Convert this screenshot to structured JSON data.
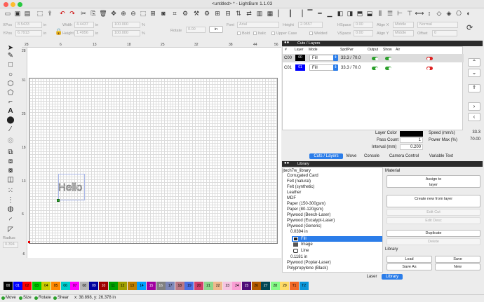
{
  "window": {
    "title": "<untitled> * - LightBurn 1.1.03"
  },
  "props_row1": {
    "xpos_label": "XPos",
    "xpos_value": "8.5433",
    "xpos_unit": "in",
    "width_label": "Width",
    "width_value": "4.4437",
    "width_unit": "in",
    "wpct": "100.000",
    "pct": "%",
    "font_label": "Font",
    "font_value": "Arial",
    "height_label": "Height",
    "height_value": "2.0557",
    "hspace_label": "HSpace",
    "hspace_value": "0.00",
    "alignx_label": "Align X",
    "alignx_value": "Middle",
    "normal_value": "Normal"
  },
  "props_row2": {
    "ypos_label": "YPos",
    "ypos_value": "6.7913",
    "ypos_unit": "in",
    "height_label": "Height",
    "height_value": "1.4956",
    "height_unit": "in",
    "hpct": "100.000",
    "pct": "%",
    "rotate_label": "Rotate",
    "rotate_value": "0.00",
    "units_button": "in",
    "bold": "Bold",
    "italic": "Italic",
    "upper": "Upper Case",
    "welded": "Welded",
    "vspace_label": "VSpace",
    "vspace_value": "0.00",
    "aligny_label": "Align Y",
    "aligny_value": "Middle",
    "offset_label": "Offset",
    "offset_value": "0"
  },
  "ruler_top": [
    "28",
    "6",
    "13",
    "18",
    "25",
    "32",
    "38",
    "44",
    "56"
  ],
  "ruler_left": [
    "28",
    "31",
    "25",
    "18",
    "13",
    "6",
    "-6"
  ],
  "canvas": {
    "text": "Hello"
  },
  "cuts_panel": {
    "title": "Cuts / Layers",
    "headers": [
      "#",
      "Layer",
      "Mode",
      "Spd/Pwr",
      "Output",
      "Show",
      "Air"
    ],
    "rows": [
      {
        "id": "C00",
        "layer": "00",
        "mode": "Fill",
        "spdpwr": "33.3 / 70.0",
        "color": "#000000"
      },
      {
        "id": "C01",
        "layer": "01",
        "mode": "Fill",
        "spdpwr": "33.3 / 70.0",
        "color": "#0000ff"
      }
    ],
    "layer_color_label": "Layer Color",
    "pass_count_label": "Pass Count",
    "pass_count_value": "1",
    "interval_label": "Interval (mm)",
    "interval_value": "0.200",
    "speed_label": "Speed (mm/s)",
    "speed_value": "33.3",
    "power_label": "Power Max (%)",
    "power_value": "70.00",
    "tabs": [
      "Cuts / Layers",
      "Move",
      "Console",
      "Camera Control",
      "Variable Text"
    ]
  },
  "library_panel": {
    "title": "Library",
    "root": "jtech7w_library",
    "items": [
      "Corrugated Card",
      "Felt (natural)",
      "Felt (synthetic)",
      "Leather",
      "MDF",
      "Paper (150-300gsm)",
      "Paper (80-120gsm)",
      "Plywood (Beech-Laser)",
      "Plywood (Eucalypt-Laser)",
      "Plywood (Generic)"
    ],
    "sub_thickness": "0.0394 in",
    "sub_items": [
      "Fill",
      "Image",
      "Line"
    ],
    "sub_thickness2": "0.1181 in",
    "items_after": [
      "Plywood (Poplar-Laser)",
      "Polypropylene (Black)"
    ],
    "material_label": "Material",
    "assign_button": "Assign to layer",
    "create_button": "Create new from layer",
    "edit_cut": "Edit Cut",
    "edit_desc": "Edit Desc",
    "duplicate": "Duplicate",
    "delete": "Delete",
    "library_label": "Library",
    "load": "Load",
    "save": "Save",
    "save_as": "Save As",
    "new": "New",
    "tabs": [
      "Laser",
      "Library"
    ]
  },
  "radius": {
    "label": "Radius:",
    "value": "0.394"
  },
  "swatches": [
    {
      "label": "00",
      "color": "#000000"
    },
    {
      "label": "01",
      "color": "#0000ff"
    },
    {
      "label": "02",
      "color": "#ff0000"
    },
    {
      "label": "03",
      "color": "#00cc00"
    },
    {
      "label": "04",
      "color": "#cccc00"
    },
    {
      "label": "05",
      "color": "#ff8800"
    },
    {
      "label": "06",
      "color": "#00cccc"
    },
    {
      "label": "07",
      "color": "#ff00ff"
    },
    {
      "label": "08",
      "color": "#b4b4b4"
    },
    {
      "label": "09",
      "color": "#0000a0"
    },
    {
      "label": "10",
      "color": "#a00000"
    },
    {
      "label": "11",
      "color": "#00a000"
    },
    {
      "label": "12",
      "color": "#a0a000"
    },
    {
      "label": "13",
      "color": "#c08000"
    },
    {
      "label": "14",
      "color": "#00a0ff"
    },
    {
      "label": "15",
      "color": "#a000a0"
    },
    {
      "label": "16",
      "color": "#808080"
    },
    {
      "label": "17",
      "color": "#7d87b9"
    },
    {
      "label": "18",
      "color": "#bb7784"
    },
    {
      "label": "19",
      "color": "#4a6fe3"
    },
    {
      "label": "20",
      "color": "#d33f6a"
    },
    {
      "label": "21",
      "color": "#8cd78c"
    },
    {
      "label": "22",
      "color": "#f0b98d"
    },
    {
      "label": "23",
      "color": "#f6c4e1"
    },
    {
      "label": "24",
      "color": "#fa9ed4"
    },
    {
      "label": "25",
      "color": "#500a78"
    },
    {
      "label": "26",
      "color": "#b45a00"
    },
    {
      "label": "27",
      "color": "#004754"
    },
    {
      "label": "28",
      "color": "#86fa88"
    },
    {
      "label": "29",
      "color": "#ffdb66"
    },
    {
      "label": "T1",
      "color": "#f36926"
    },
    {
      "label": "T2",
      "color": "#0c96d9"
    }
  ],
  "status": {
    "move": "Move",
    "size": "Size",
    "rotate": "Rotate",
    "shear": "Shear",
    "coords": "x: 38.898, y: 26.378 in"
  }
}
